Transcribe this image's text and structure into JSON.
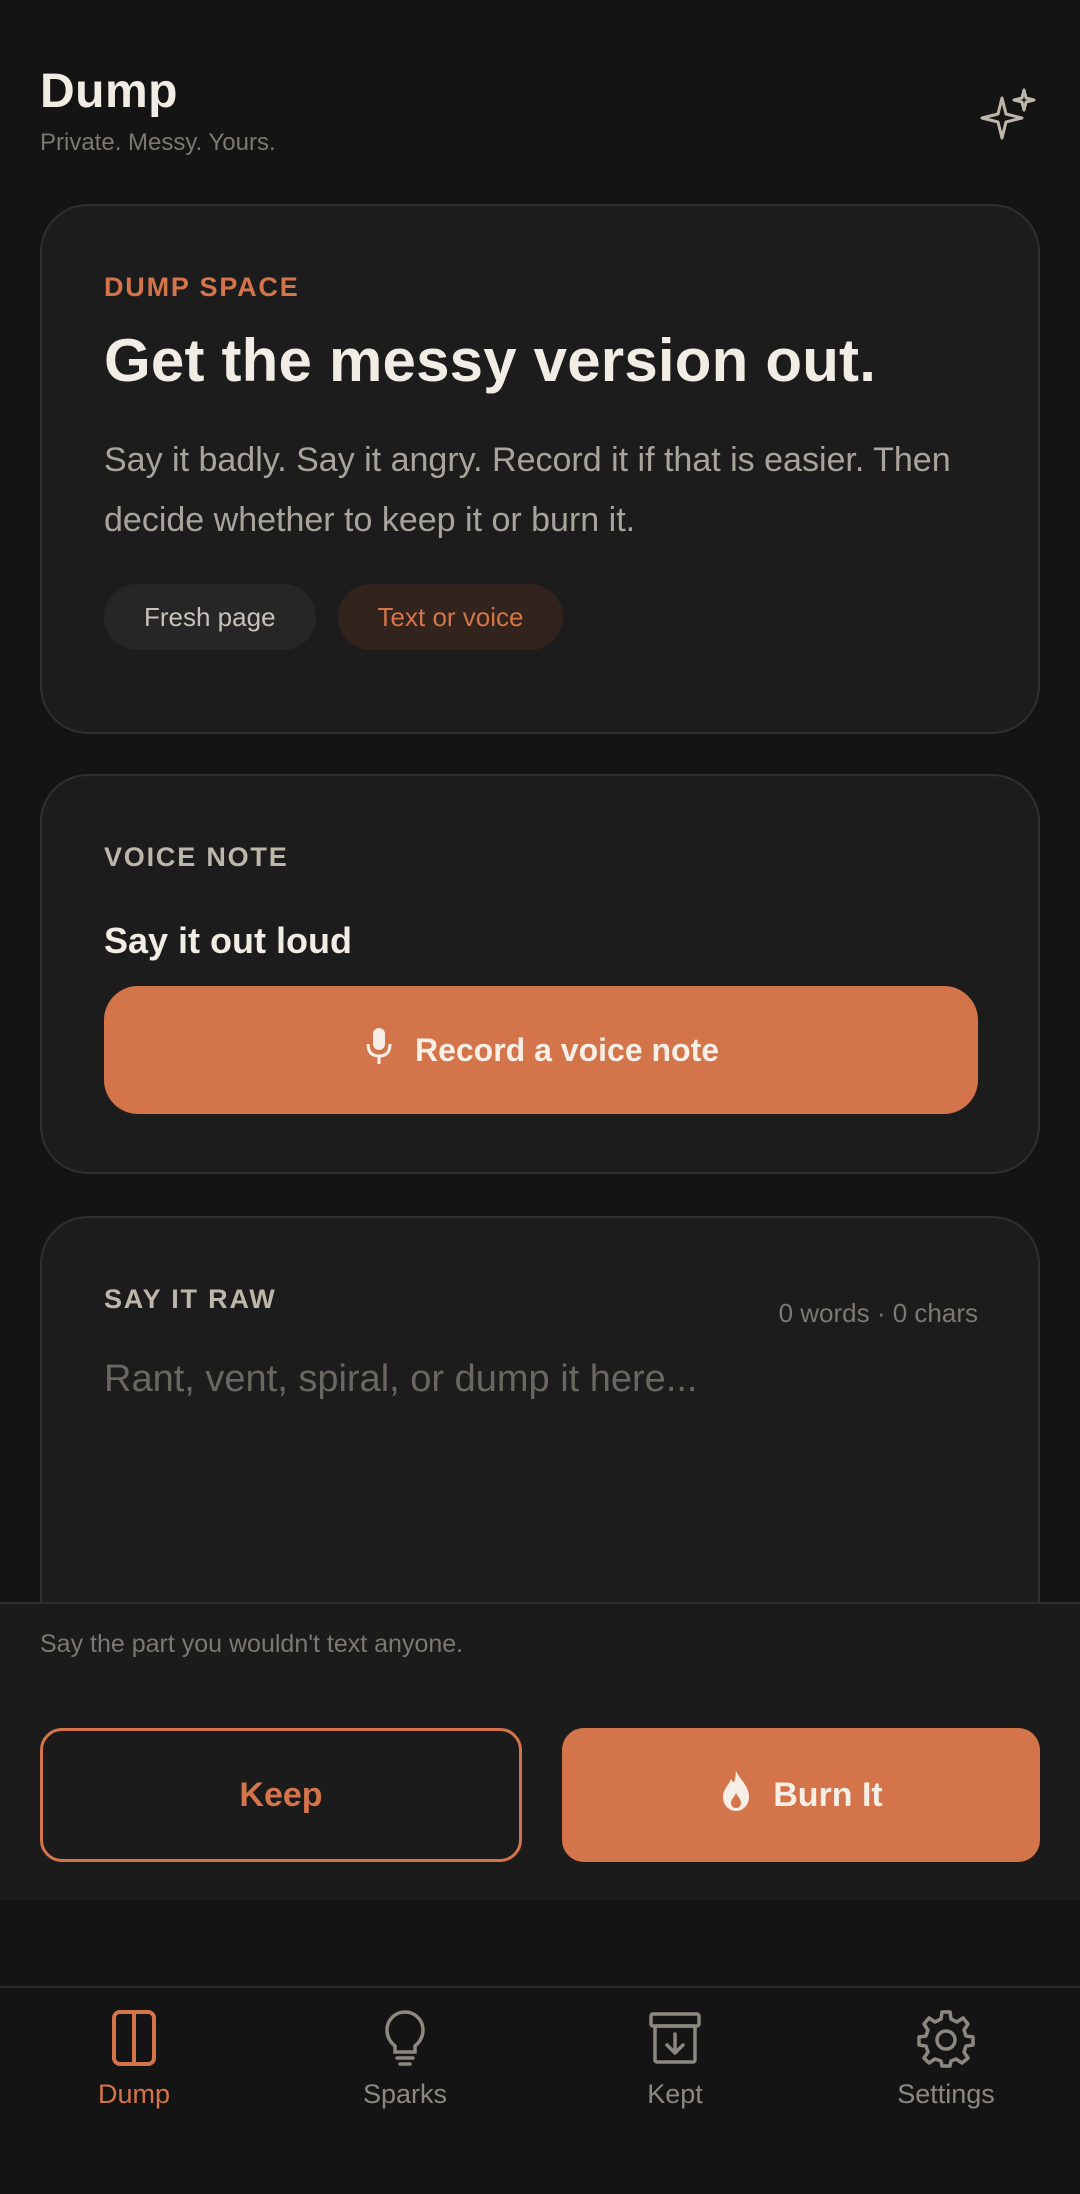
{
  "header": {
    "title": "Dump",
    "subtitle": "Private. Messy. Yours.",
    "sparkle_icon": "sparkles-icon"
  },
  "dump_card": {
    "eyebrow": "DUMP SPACE",
    "headline": "Get the messy version out.",
    "body": "Say it badly. Say it angry. Record it if that is easier. Then decide whether to keep it or burn it.",
    "pills": [
      "Fresh page",
      "Text or voice"
    ]
  },
  "voice_card": {
    "eyebrow": "VOICE NOTE",
    "heading": "Say it out loud",
    "record_label": "Record a voice note",
    "icon": "microphone-icon"
  },
  "raw_card": {
    "eyebrow": "SAY IT RAW",
    "counts": "0 words · 0 chars",
    "placeholder": "Rant, vent, spiral, or dump it here..."
  },
  "action_bar": {
    "hint": "Say the part you wouldn't text anyone.",
    "keep_label": "Keep",
    "burn_label": "Burn It",
    "burn_icon": "flame-icon"
  },
  "nav": {
    "items": [
      {
        "label": "Dump",
        "icon": "book-icon",
        "active": true
      },
      {
        "label": "Sparks",
        "icon": "lightbulb-icon",
        "active": false
      },
      {
        "label": "Kept",
        "icon": "archive-icon",
        "active": false
      },
      {
        "label": "Settings",
        "icon": "gear-icon",
        "active": false
      }
    ]
  },
  "colors": {
    "accent": "#d4744a",
    "background": "#141414",
    "card": "#1c1c1c",
    "text": "#f2ede4"
  }
}
